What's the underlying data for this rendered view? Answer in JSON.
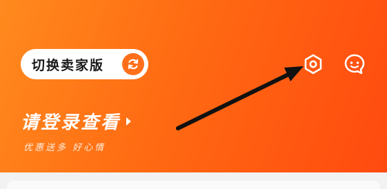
{
  "header": {
    "switch_button_label": "切换卖家版",
    "login_prompt": "请登录查看",
    "subtitle": "优惠送多 好心情"
  },
  "icons": {
    "switch": "refresh-icon",
    "settings": "settings-hexagon-icon",
    "message": "chat-bubble-icon",
    "login_caret": "caret-right-icon",
    "annotation": "arrow-annotation"
  },
  "colors": {
    "header_gradient_start": "#ff8a1e",
    "header_gradient_end": "#ff4a10",
    "accent": "#ff6f1a",
    "pill_bg": "#ffffff",
    "page_bg": "#f2f2f2"
  }
}
